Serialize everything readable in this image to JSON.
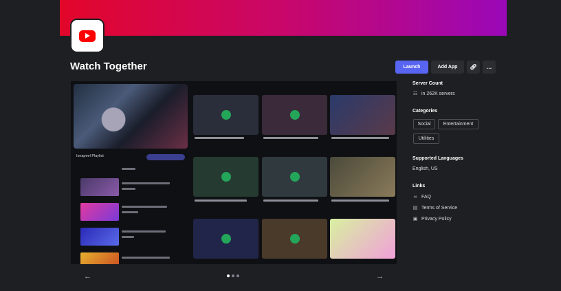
{
  "app": {
    "name": "Watch Together"
  },
  "actions": {
    "launch_label": "Launch",
    "add_app_label": "Add App",
    "link_icon": "link-icon",
    "more_icon": "more-icon"
  },
  "media": {
    "playlist_title": "Iseapeel Playlist",
    "carousel": {
      "slides": 3,
      "active_index": 0
    }
  },
  "sidebar": {
    "server_count": {
      "heading": "Server Count",
      "value": "in 262K servers"
    },
    "categories": {
      "heading": "Categories",
      "items": [
        "Social",
        "Entertainment",
        "Utilities"
      ]
    },
    "languages": {
      "heading": "Supported Languages",
      "value": "English, US"
    },
    "links": {
      "heading": "Links",
      "items": [
        {
          "label": "FAQ",
          "icon": "link-icon"
        },
        {
          "label": "Terms of Service",
          "icon": "document-icon"
        },
        {
          "label": "Privacy Policy",
          "icon": "lock-icon"
        }
      ]
    }
  },
  "colors": {
    "accent": "#5865f2",
    "banner_start": "#e2062a",
    "banner_end": "#9a08b8",
    "background": "#1e1f22"
  }
}
